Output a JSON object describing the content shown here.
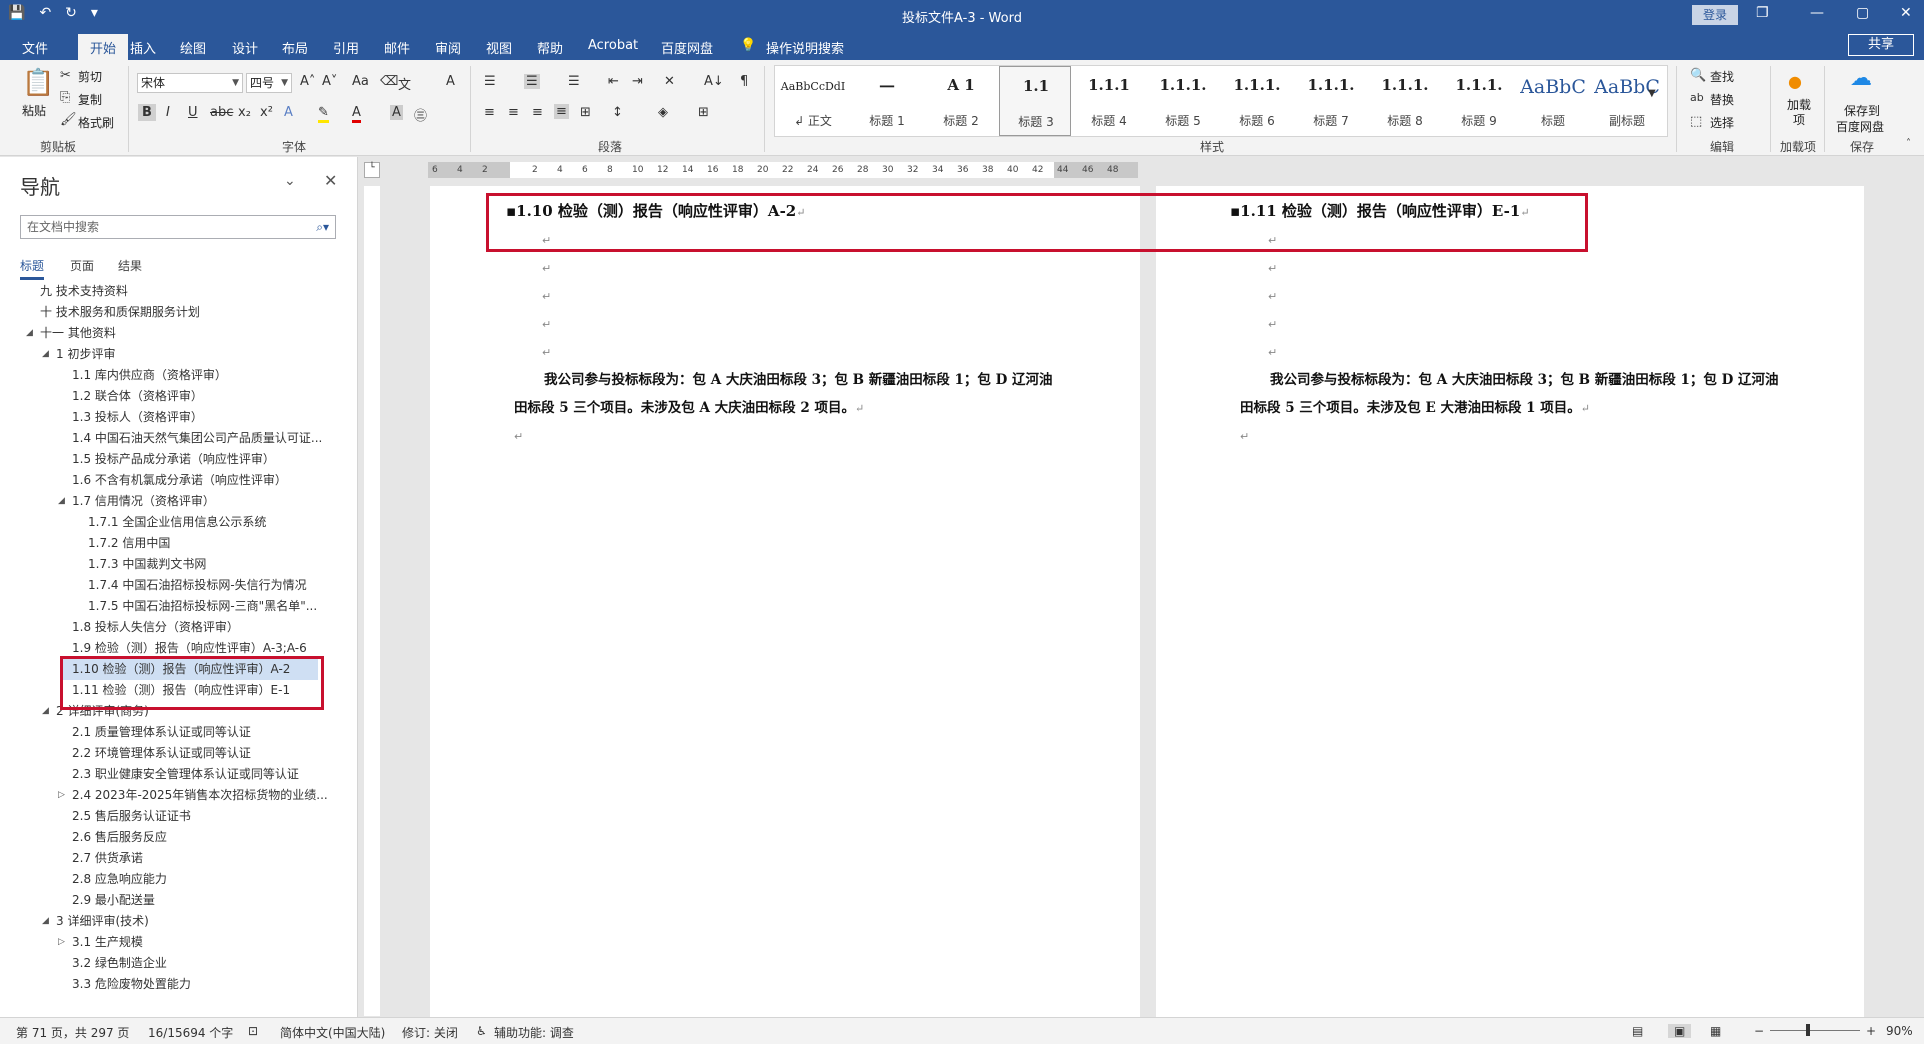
{
  "titlebar": {
    "title": "投标文件A-3 - Word",
    "login": "登录",
    "save_icon": "💾",
    "undo_icon": "↶",
    "redo_icon": "↻",
    "customize_icon": "▾",
    "restore_icon": "❐",
    "minimize_icon": "—",
    "maximize_icon": "▢",
    "close_icon": "✕"
  },
  "tabs": {
    "file": "文件",
    "home": "开始",
    "insert": "插入",
    "draw": "绘图",
    "design": "设计",
    "layout": "布局",
    "references": "引用",
    "mail": "邮件",
    "review": "审阅",
    "view": "视图",
    "help": "帮助",
    "acrobat": "Acrobat",
    "baidu": "百度网盘",
    "tell_me": "操作说明搜索",
    "share": "共享"
  },
  "ribbon": {
    "clipboard": {
      "paste": "粘贴",
      "cut": "剪切",
      "copy": "复制",
      "format_painter": "格式刷",
      "label": "剪贴板"
    },
    "font": {
      "name": "宋体",
      "size": "四号",
      "label": "字体"
    },
    "paragraph": {
      "label": "段落"
    },
    "styles": {
      "label": "样式",
      "items": [
        {
          "preview": "AaBbCcDdI",
          "name": "↲ 正文"
        },
        {
          "preview": "一",
          "name": "标题 1"
        },
        {
          "preview": "A 1",
          "name": "标题 2"
        },
        {
          "preview": "1.1",
          "name": "标题 3"
        },
        {
          "preview": "1.1.1",
          "name": "标题 4"
        },
        {
          "preview": "1.1.1.",
          "name": "标题 5"
        },
        {
          "preview": "1.1.1.",
          "name": "标题 6"
        },
        {
          "preview": "1.1.1.",
          "name": "标题 7"
        },
        {
          "preview": "1.1.1.",
          "name": "标题 8"
        },
        {
          "preview": "1.1.1.",
          "name": "标题 9"
        },
        {
          "preview": "AaBbC",
          "name": "标题"
        },
        {
          "preview": "AaBbC",
          "name": "副标题"
        }
      ],
      "selected": 3
    },
    "editing": {
      "find": "查找",
      "replace": "替换",
      "select": "选择",
      "label": "编辑"
    },
    "addins": {
      "btn": "加载项",
      "label": "加载项"
    },
    "save": {
      "btn1": "保存到",
      "btn2": "百度网盘",
      "label": "保存"
    }
  },
  "nav": {
    "title": "导航",
    "search_placeholder": "在文档中搜索",
    "tabs": [
      "标题",
      "页面",
      "结果"
    ],
    "items": [
      {
        "label": "九 技术支持资料",
        "level": 0,
        "exp": ""
      },
      {
        "label": "十 技术服务和质保期服务计划",
        "level": 0,
        "exp": ""
      },
      {
        "label": "十一 其他资料",
        "level": 0,
        "exp": "◢"
      },
      {
        "label": "1 初步评审",
        "level": 1,
        "exp": "◢"
      },
      {
        "label": "1.1 库内供应商（资格评审）",
        "level": 2,
        "exp": ""
      },
      {
        "label": "1.2 联合体（资格评审）",
        "level": 2,
        "exp": ""
      },
      {
        "label": "1.3 投标人（资格评审）",
        "level": 2,
        "exp": ""
      },
      {
        "label": "1.4 中国石油天然气集团公司产品质量认可证...",
        "level": 2,
        "exp": ""
      },
      {
        "label": "1.5 投标产品成分承诺（响应性评审）",
        "level": 2,
        "exp": ""
      },
      {
        "label": "1.6 不含有机氯成分承诺（响应性评审）",
        "level": 2,
        "exp": ""
      },
      {
        "label": "1.7 信用情况（资格评审）",
        "level": 2,
        "exp": "◢"
      },
      {
        "label": "1.7.1 全国企业信用信息公示系统",
        "level": 3,
        "exp": ""
      },
      {
        "label": "1.7.2 信用中国",
        "level": 3,
        "exp": ""
      },
      {
        "label": "1.7.3 中国裁判文书网",
        "level": 3,
        "exp": ""
      },
      {
        "label": "1.7.4 中国石油招标投标网-失信行为情况",
        "level": 3,
        "exp": ""
      },
      {
        "label": "1.7.5 中国石油招标投标网-三商\"黑名单\"...",
        "level": 3,
        "exp": ""
      },
      {
        "label": "1.8 投标人失信分（资格评审）",
        "level": 2,
        "exp": ""
      },
      {
        "label": "1.9 检验（测）报告（响应性评审）A-3;A-6",
        "level": 2,
        "exp": ""
      },
      {
        "label": "1.10 检验（测）报告（响应性评审）A-2",
        "level": 2,
        "exp": "",
        "hl": true
      },
      {
        "label": "1.11 检验（测）报告（响应性评审）E-1",
        "level": 2,
        "exp": ""
      },
      {
        "label": "2 详细评审(商务)",
        "level": 1,
        "exp": "◢"
      },
      {
        "label": "2.1 质量管理体系认证或同等认证",
        "level": 2,
        "exp": ""
      },
      {
        "label": "2.2 环境管理体系认证或同等认证",
        "level": 2,
        "exp": ""
      },
      {
        "label": "2.3 职业健康安全管理体系认证或同等认证",
        "level": 2,
        "exp": ""
      },
      {
        "label": "2.4 2023年-2025年销售本次招标货物的业绩...",
        "level": 2,
        "exp": "▷"
      },
      {
        "label": "2.5 售后服务认证证书",
        "level": 2,
        "exp": ""
      },
      {
        "label": "2.6 售后服务反应",
        "level": 2,
        "exp": ""
      },
      {
        "label": "2.7 供货承诺",
        "level": 2,
        "exp": ""
      },
      {
        "label": "2.8 应急响应能力",
        "level": 2,
        "exp": ""
      },
      {
        "label": "2.9 最小配送量",
        "level": 2,
        "exp": ""
      },
      {
        "label": "3 详细评审(技术)",
        "level": 1,
        "exp": "◢"
      },
      {
        "label": "3.1 生产规模",
        "level": 2,
        "exp": "▷"
      },
      {
        "label": "3.2 绿色制造企业",
        "level": 2,
        "exp": ""
      },
      {
        "label": "3.3 危险废物处置能力",
        "level": 2,
        "exp": ""
      }
    ]
  },
  "ruler": {
    "ticks": [
      "6",
      "4",
      "2",
      "",
      "2",
      "4",
      "6",
      "8",
      "10",
      "12",
      "14",
      "16",
      "18",
      "20",
      "22",
      "24",
      "26",
      "28",
      "30",
      "32",
      "34",
      "36",
      "38",
      "40",
      "42",
      "44",
      "46",
      "48"
    ]
  },
  "pages": [
    {
      "heading": "1.10  检验（测）报告（响应性评审）A-2",
      "para1": "我公司参与投标标段为：包 A 大庆油田标段 3；包 B 新疆油田标段 1；包 D 辽河油",
      "para2": "田标段 5 三个项目。未涉及包 A 大庆油田标段 2 项目。"
    },
    {
      "heading": "1.11  检验（测）报告（响应性评审）E-1",
      "para1": "我公司参与投标标段为：包 A 大庆油田标段 3；包 B 新疆油田标段 1；包 D 辽河油",
      "para2": "田标段 5 三个项目。未涉及包 E 大港油田标段 1 项目。"
    }
  ],
  "status": {
    "page": "第 71 页，共 297 页",
    "words": "16/15694 个字",
    "lang": "简体中文(中国大陆)",
    "track": "修订: 关闭",
    "access": "辅助功能: 调查",
    "zoom": "90%"
  }
}
